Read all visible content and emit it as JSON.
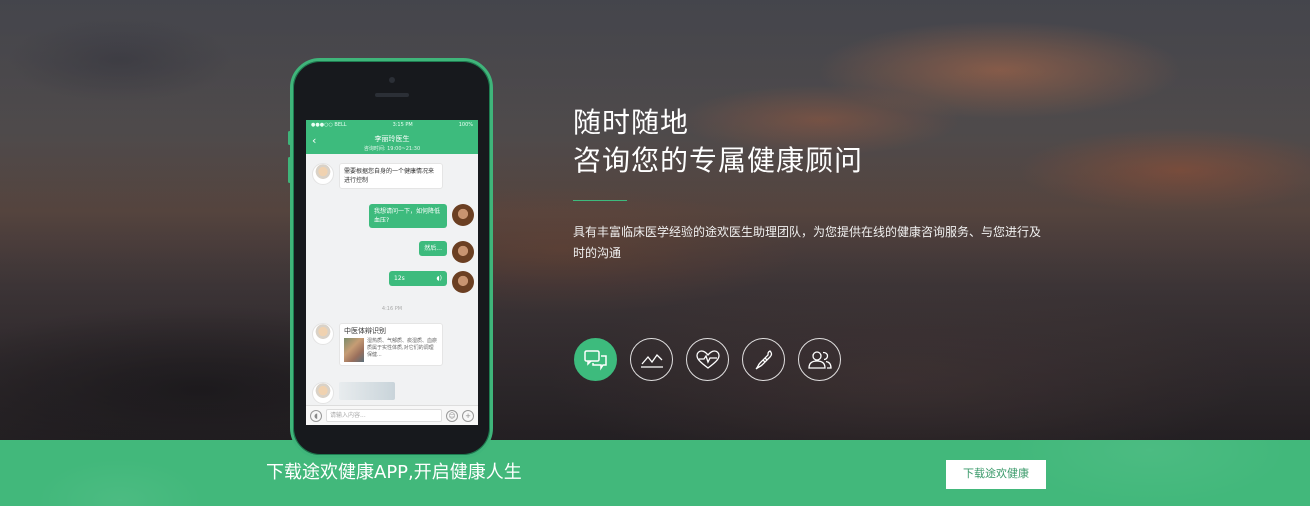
{
  "hero": {
    "headline_line1": "随时随地",
    "headline_line2": "咨询您的专属健康顾问",
    "description": "具有丰富临床医学经验的途欢医生助理团队，为您提供在线的健康咨询服务、与您进行及时的沟通"
  },
  "features": [
    {
      "icon": "chat-bubbles-icon",
      "active": true
    },
    {
      "icon": "trend-chart-icon",
      "active": false
    },
    {
      "icon": "heart-pulse-icon",
      "active": false
    },
    {
      "icon": "thermometer-icon",
      "active": false
    },
    {
      "icon": "users-icon",
      "active": false
    }
  ],
  "phone": {
    "status_left": "●●●○○ BELL",
    "status_time": "3:15 PM",
    "status_right": "100%",
    "doctor_name": "李丽玲医生",
    "consult_time": "咨询时间: 19:00~21:30",
    "messages": {
      "m1": "需要根据您自身的一个健康情况来进行控制",
      "m2": "我想请问一下，如何降低血压?",
      "m3": "然后...",
      "m4": "12s",
      "timestamp": "4:16 PM",
      "card_title": "中医体辩识别",
      "card_text": "湿热质、气郁质、痰湿质、血瘀质属于实性体质,对它们的调理保健..."
    },
    "input_placeholder": "请输入内容..."
  },
  "download": {
    "title": "下载途欢健康APP,开启健康人生",
    "button": "下载途欢健康"
  },
  "colors": {
    "brand_green": "#3dbb7d",
    "bar_green": "#42b87b"
  }
}
